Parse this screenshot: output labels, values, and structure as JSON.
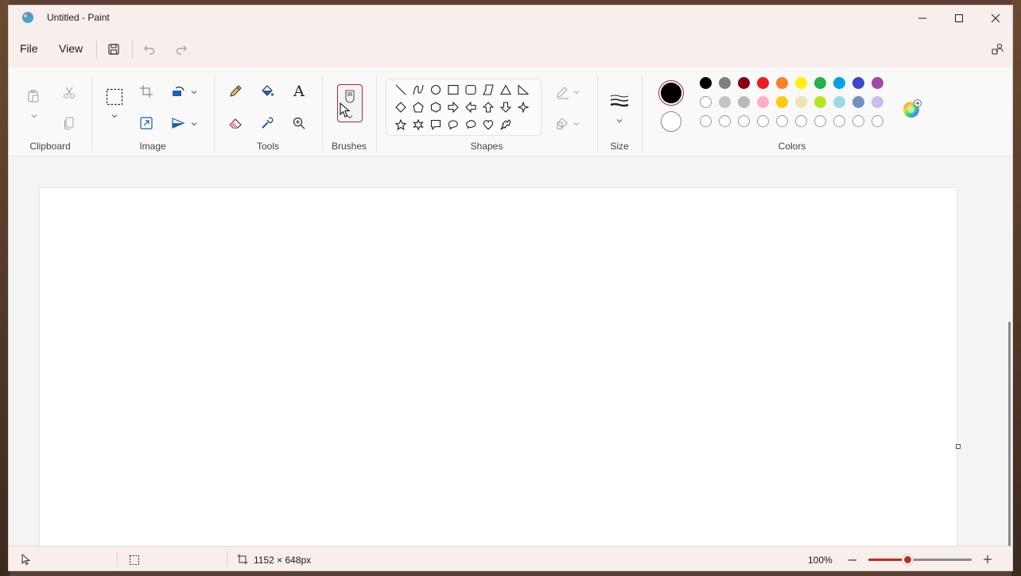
{
  "window": {
    "title": "Untitled - Paint"
  },
  "menu": {
    "file": "File",
    "view": "View"
  },
  "ribbon": {
    "groups": {
      "clipboard": "Clipboard",
      "image": "Image",
      "tools": "Tools",
      "brushes": "Brushes",
      "shapes": "Shapes",
      "size": "Size",
      "colors": "Colors"
    },
    "text_tool_glyph": "A",
    "primary_color": "#000000",
    "secondary_color": "#ffffff",
    "palette_row1": [
      "#000000",
      "#7f7f7f",
      "#880015",
      "#ed1c24",
      "#ff7f27",
      "#fff200",
      "#22b14c",
      "#00a2e8",
      "#3f48cc",
      "#a349a4"
    ],
    "palette_row2": [
      "#ffffff",
      "#c3c3c3",
      "#b9b9b9",
      "#ffaec9",
      "#ffc90e",
      "#efe4b0",
      "#b5e61d",
      "#99d9ea",
      "#7092be",
      "#c8bfe7"
    ],
    "palette_row3": [
      "#ffffff",
      "#ffffff",
      "#ffffff",
      "#ffffff",
      "#ffffff",
      "#ffffff",
      "#ffffff",
      "#ffffff",
      "#ffffff",
      "#ffffff"
    ],
    "accent": "#b3262b"
  },
  "status": {
    "canvas_size": "1152 × 648px",
    "zoom_label": "100%",
    "zoom_fraction": 0.38
  }
}
